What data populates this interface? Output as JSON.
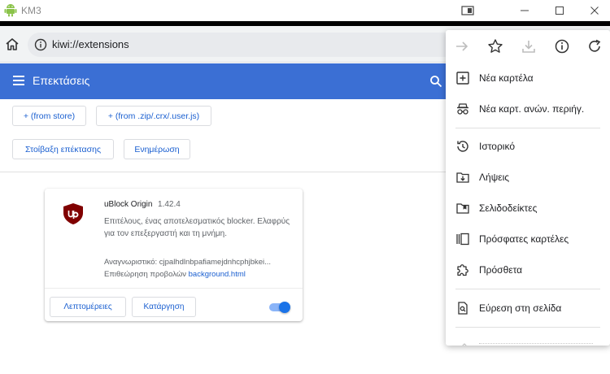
{
  "window": {
    "title": "KM3",
    "icons": [
      "android-icon",
      "cast-icon",
      "minimize-icon",
      "maximize-icon",
      "close-icon"
    ]
  },
  "toolbar": {
    "url": "kiwi://extensions",
    "icons": [
      "home-icon",
      "info-icon"
    ]
  },
  "header": {
    "title": "Επεκτάσεις",
    "icons": [
      "menu-icon",
      "search-icon"
    ]
  },
  "actions": {
    "from_store": "+ (from store)",
    "from_file": "+ (from .zip/.crx/.user.js)",
    "pack": "Στοίβαξη επέκτασης",
    "update": "Ενημέρωση"
  },
  "extension": {
    "name": "uBlock Origin",
    "version": "1.42.4",
    "description": "Επιτέλους, ένας αποτελεσματικός blocker. Ελαφρύς για τον επεξεργαστή και τη μνήμη.",
    "id_label": "Αναγνωριστικό: cjpalhdlnbpafiamejdnhcphjbkei...",
    "inspect_label": "Επιθεώρηση προβολών",
    "inspect_link": "background.html",
    "details_button": "Λεπτομέρειες",
    "remove_button": "Κατάργηση",
    "enabled": true,
    "icon": "ublock-shield-icon"
  },
  "menu": {
    "top_icons": [
      "forward-arrow-icon",
      "star-icon",
      "download-icon",
      "info-icon",
      "refresh-icon"
    ],
    "items": [
      {
        "label": "Νέα καρτέλα",
        "icon": "new-tab-icon"
      },
      {
        "label": "Νέα καρτ. ανών. περιήγ.",
        "icon": "incognito-icon"
      },
      {
        "label": "Ιστορικό",
        "icon": "history-icon"
      },
      {
        "label": "Λήψεις",
        "icon": "downloads-icon"
      },
      {
        "label": "Σελιδοδείκτες",
        "icon": "bookmarks-icon"
      },
      {
        "label": "Πρόσφατες καρτέλες",
        "icon": "recent-tabs-icon"
      },
      {
        "label": "Πρόσθετα",
        "icon": "puzzle-icon"
      },
      {
        "label": "Εύρεση στη σελίδα",
        "icon": "find-in-page-icon"
      }
    ]
  },
  "colors": {
    "header": "#3b6fd4",
    "accent": "#1a73e8",
    "ublock": "#800000"
  }
}
